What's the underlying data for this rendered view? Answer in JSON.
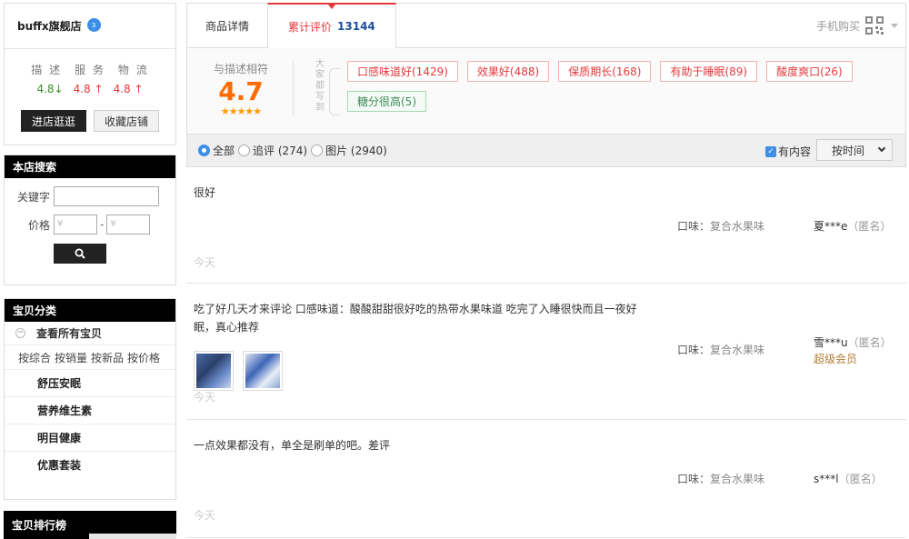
{
  "shop": {
    "name": "buffx旗舰店",
    "badge": "3",
    "rating_labels": [
      "描 述",
      "服 务",
      "物 流"
    ],
    "ratings": [
      {
        "value": "4.8",
        "arrow": "↓",
        "trend": "down"
      },
      {
        "value": "4.8",
        "arrow": "↑",
        "trend": "up"
      },
      {
        "value": "4.8",
        "arrow": "↑",
        "trend": "up"
      }
    ],
    "enter_shop": "进店逛逛",
    "fav_shop": "收藏店铺"
  },
  "search": {
    "title": "本店搜索",
    "keyword_label": "关键字",
    "price_label": "价格",
    "price_min_placeholder": "¥",
    "price_max_placeholder": "¥",
    "dash": "-"
  },
  "category": {
    "title": "宝贝分类",
    "view_all": "查看所有宝贝",
    "sort_links": [
      "按综合",
      "按销量",
      "按新品",
      "按价格"
    ],
    "items": [
      "舒压安眠",
      "营养维生素",
      "明目健康",
      "优惠套装"
    ]
  },
  "ranking": {
    "title": "宝贝排行榜"
  },
  "tabs": {
    "detail": "商品详情",
    "reviews": "累计评价",
    "review_count": "13144",
    "mobile_buy": "手机购买"
  },
  "summary": {
    "score_label": "与描述相符",
    "score": "4.7",
    "stars": "★★★★★",
    "dajia_chars": [
      "大",
      "家",
      "都",
      "写",
      "到"
    ],
    "tags": [
      {
        "text": "口感味道好(1429)",
        "tone": "red"
      },
      {
        "text": "效果好(488)",
        "tone": "red"
      },
      {
        "text": "保质期长(168)",
        "tone": "red"
      },
      {
        "text": "有助于睡眠(89)",
        "tone": "red"
      },
      {
        "text": "酸度爽口(26)",
        "tone": "red"
      },
      {
        "text": "糖分很高(5)",
        "tone": "green"
      }
    ]
  },
  "filter": {
    "all": "全部",
    "append": "追评 (274)",
    "pictures": "图片 (2940)",
    "has_content": "有内容",
    "sort": "按时间"
  },
  "reviews": [
    {
      "text": "很好",
      "date": "今天",
      "flavor_label": "口味：",
      "flavor_value": "复合水果味",
      "user": "夏***e",
      "anon": "（匿名）",
      "vip": ""
    },
    {
      "text": "吃了好几天才来评论 口感味道：酸酸甜甜很好吃的热带水果味道 吃完了入睡很快而且一夜好眠，真心推荐",
      "date": "今天",
      "flavor_label": "口味：",
      "flavor_value": "复合水果味",
      "user": "雪***u",
      "anon": "（匿名）",
      "vip": "超级会员"
    },
    {
      "text": "一点效果都没有，单全是刷单的吧。差评",
      "date": "今天",
      "flavor_label": "口味：",
      "flavor_value": "复合水果味",
      "user": "s***l",
      "anon": "（匿名）",
      "vip": ""
    }
  ],
  "colors": {
    "accent_red": "#e4393c",
    "score_orange": "#ff6b00",
    "link_blue": "#1f4e9b",
    "vip_gold": "#b47d33",
    "down_green": "#3a8a2b"
  }
}
